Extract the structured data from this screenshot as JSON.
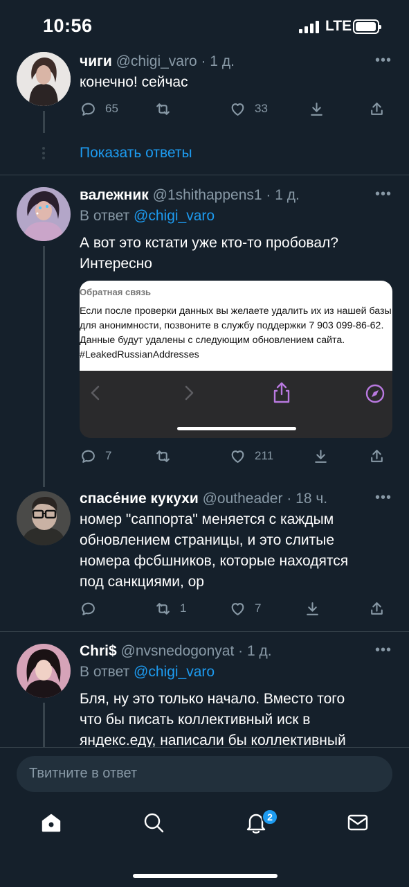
{
  "status_bar": {
    "time": "10:56",
    "network": "LTE",
    "battery_level": 0.95
  },
  "colors": {
    "background": "#15202b",
    "accent": "#1d9bf0",
    "muted": "#8899a6",
    "divider": "#38444d"
  },
  "tweets": [
    {
      "name": "чиги",
      "meta": "@chigi_varo · 1 д.",
      "text": "конечно! сейчас",
      "replies": "65",
      "retweets": "",
      "likes": "33"
    },
    {
      "name": "валежник",
      "meta": "@1shithappens1 · 1 д.",
      "reply_prefix": "В ответ",
      "reply_handle": "@chigi_varo",
      "text_lines": [
        "А вот это кстати уже кто-то пробовал?",
        "Интересно"
      ],
      "media": {
        "title": "Обратная связь",
        "lines": [
          "Если после проверки данных вы желаете удалить их из нашей базы",
          "для анонимности, позвоните в службу поддержки 7 903 099-86-62.",
          "Данные будут удалены с следующим обновлением сайта.",
          "#LeakedRussianAddresses"
        ]
      },
      "replies": "7",
      "retweets": "",
      "likes": "211"
    },
    {
      "name": "спасе́ние кукухи",
      "meta": "@outheader · 18 ч.",
      "text_lines": [
        "номер \"саппорта\" меняется с каждым",
        "обновлением страницы, и это слитые",
        "номера фсбшников, которые находятся",
        "под санкциями, ор"
      ],
      "replies": "",
      "retweets": "1",
      "likes": "7"
    },
    {
      "name": "Chri$",
      "meta": "@nvsnedogonyat · 1 д.",
      "reply_prefix": "В ответ",
      "reply_handle": "@chigi_varo",
      "text_lines": [
        "Бля, ну это только начало. Вместо того",
        "что бы писать коллективный иск в",
        "яндекс.еду, написали бы коллективный"
      ]
    }
  ],
  "show_replies": "Показать ответы",
  "more_glyph": "•••",
  "compose": {
    "placeholder": "Твитните в ответ"
  },
  "tabbar": {
    "items": [
      "home-icon",
      "search-icon",
      "notifications-icon",
      "messages-icon"
    ],
    "notifications_badge": "2"
  }
}
